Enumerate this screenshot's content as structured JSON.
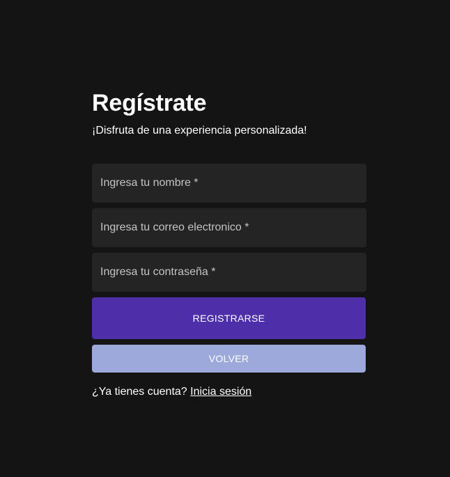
{
  "register": {
    "title": "Regístrate",
    "subtitle": "¡Disfruta de una experiencia personalizada!",
    "fields": {
      "name_placeholder": "Ingresa tu nombre *",
      "email_placeholder": "Ingresa tu correo electronico *",
      "password_placeholder": "Ingresa tu contraseña *"
    },
    "buttons": {
      "register_label": "REGISTRARSE",
      "back_label": "VOLVER"
    },
    "footer": {
      "prompt": "¿Ya tienes cuenta?",
      "login_link": "Inicia sesión"
    }
  },
  "colors": {
    "background": "#141414",
    "field_background": "#242424",
    "primary_button": "#4f2fa9",
    "secondary_button": "#9ea9db"
  }
}
